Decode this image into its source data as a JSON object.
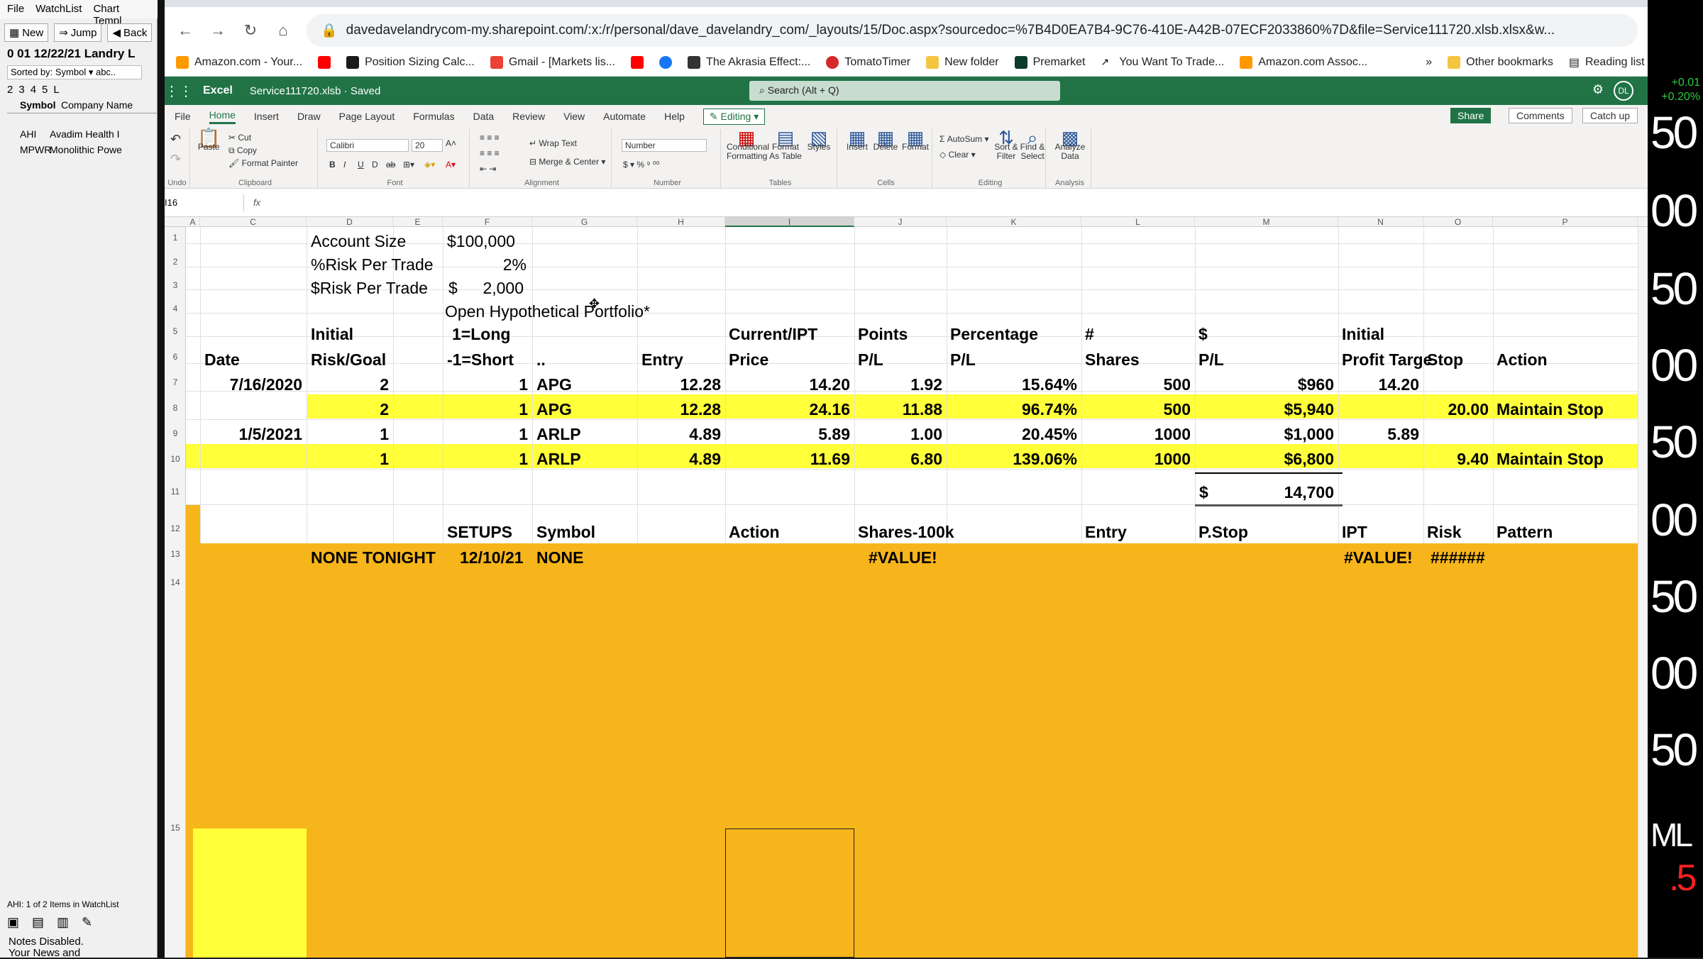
{
  "left_app": {
    "menu": [
      "File",
      "WatchList",
      "Chart Templ"
    ],
    "toolbar": {
      "new": "New",
      "jump": "Jump",
      "back": "Back"
    },
    "title": "0 01 12/22/21 Landry L",
    "sort_label": "Sorted by: Symbol ▾ abc..",
    "tabs": [
      "2",
      "3",
      "4",
      "5",
      "L"
    ],
    "columns": [
      "Symbol",
      "Company Name"
    ],
    "rows": [
      {
        "symbol": "AHI",
        "company": "Avadim Health I"
      },
      {
        "symbol": "MPWR",
        "company": "Monolithic Powe"
      }
    ],
    "status": "AHI: 1 of 2 Items in WatchList",
    "notes": [
      "Notes Disabled.",
      "Your News and"
    ]
  },
  "price_scale": {
    "change1": "+0.01",
    "change2": "+0.20%",
    "labels": [
      "50",
      "00",
      "50",
      "00",
      "50",
      "00",
      "50",
      "00",
      "50"
    ],
    "footer1": "ML",
    "footer2": ".5"
  },
  "browser": {
    "url": "davedavelandrycom-my.sharepoint.com/:x:/r/personal/dave_davelandry_com/_layouts/15/Doc.aspx?sourcedoc=%7B4D0EA7B4-9C76-410E-A42B-07ECF2033860%7D&file=Service111720.xlsb.xlsx&w...",
    "bookmarks": [
      "Amazon.com - Your...",
      "Position Sizing Calc...",
      "Gmail - [Markets lis...",
      "The Akrasia Effect:...",
      "TomatoTimer",
      "New folder",
      "Premarket",
      "You Want To Trade...",
      "Amazon.com Assoc..."
    ],
    "other_bookmarks": "Other bookmarks",
    "reading_list": "Reading list"
  },
  "excel": {
    "app_name": "Excel",
    "doc_title": "Service111720.xlsb · Saved",
    "search_placeholder": "Search (Alt + Q)",
    "avatar": "DL",
    "tabs": [
      "File",
      "Home",
      "Insert",
      "Draw",
      "Page Layout",
      "Formulas",
      "Data",
      "Review",
      "View",
      "Automate",
      "Help"
    ],
    "active_tab": "Home",
    "editing": "Editing",
    "share": "Share",
    "comments": "Comments",
    "catchup": "Catch up",
    "ribbon": {
      "undo_label": "Undo",
      "paste": "Paste",
      "cut": "Cut",
      "copy": "Copy",
      "format_painter": "Format Painter",
      "clipboard": "Clipboard",
      "font_name": "Calibri",
      "font_size": "20",
      "font": "Font",
      "wrap_text": "Wrap Text",
      "merge_center": "Merge & Center",
      "alignment": "Alignment",
      "number_format": "Number",
      "number": "Number",
      "conditional_formatting": "Conditional Formatting",
      "format_as_table": "Format As Table",
      "styles": "Styles",
      "tables": "Tables",
      "insert": "Insert",
      "delete": "Delete",
      "format": "Format",
      "cells": "Cells",
      "autosum": "AutoSum",
      "clear": "Clear",
      "sort_filter": "Sort & Filter",
      "find_select": "Find & Select",
      "editing_group": "Editing",
      "analyze_data": "Analyze Data",
      "analysis": "Analysis"
    },
    "name_box": "I16",
    "fx": "fx",
    "columns": [
      "A",
      "C",
      "D",
      "E",
      "F",
      "G",
      "H",
      "I",
      "J",
      "K",
      "L",
      "M",
      "N",
      "O",
      "P"
    ],
    "row_numbers": [
      "1",
      "2",
      "3",
      "4",
      "5",
      "6",
      "7",
      "8",
      "9",
      "10",
      "11",
      "12",
      "13",
      "14",
      "15"
    ],
    "sheet": {
      "account_size_label": "Account Size",
      "account_size": "$100,000",
      "risk_pct_label": "%Risk Per Trade",
      "risk_pct": "2%",
      "risk_dollar_label": "$Risk Per Trade",
      "risk_dollar_sign": "$",
      "risk_dollar": "2,000",
      "portfolio_title": "Open Hypothetical Portfolio*",
      "hdr5": {
        "d": "Initial",
        "f": "1=Long",
        "i": "Current/IPT",
        "j": "Points",
        "k": "Percentage",
        "l": "#",
        "m": "$",
        "n": "Initial"
      },
      "hdr6": {
        "c": "Date",
        "d": "Risk/Goal",
        "f": "-1=Short",
        "g": "..",
        "h": "Entry",
        "i": "Price",
        "j": "P/L",
        "k": "P/L",
        "l": "Shares",
        "m": "P/L",
        "n": "Profit Targe",
        "o": "Stop",
        "p": "Action"
      },
      "rows": [
        {
          "date": "7/16/2020",
          "risk": "2",
          "ls": "1",
          "sym": "APG",
          "entry": "12.28",
          "price": "14.20",
          "pts": "1.92",
          "pct": "15.64%",
          "shares": "500",
          "pl": "$960",
          "target": "14.20",
          "stop": "",
          "action": ""
        },
        {
          "date": "",
          "risk": "2",
          "ls": "1",
          "sym": "APG",
          "entry": "12.28",
          "price": "24.16",
          "pts": "11.88",
          "pct": "96.74%",
          "shares": "500",
          "pl": "$5,940",
          "target": "",
          "stop": "20.00",
          "action": "Maintain Stop"
        },
        {
          "date": "1/5/2021",
          "risk": "1",
          "ls": "1",
          "sym": "ARLP",
          "entry": "4.89",
          "price": "5.89",
          "pts": "1.00",
          "pct": "20.45%",
          "shares": "1000",
          "pl": "$1,000",
          "target": "5.89",
          "stop": "",
          "action": ""
        },
        {
          "date": "",
          "risk": "1",
          "ls": "1",
          "sym": "ARLP",
          "entry": "4.89",
          "price": "11.69",
          "pts": "6.80",
          "pct": "139.06%",
          "shares": "1000",
          "pl": "$6,800",
          "target": "",
          "stop": "9.40",
          "action": "Maintain Stop"
        }
      ],
      "total_sign": "$",
      "total": "14,700",
      "hdr12": {
        "f": "SETUPS",
        "g": "Symbol",
        "i": "Action",
        "j": "Shares-100k",
        "l": "Entry",
        "m": "P.Stop",
        "n": "IPT",
        "o": "Risk",
        "p": "Pattern"
      },
      "row13": {
        "d": "NONE TONIGHT",
        "f": "12/10/21",
        "g": "NONE",
        "j": "#VALUE!",
        "n": "#VALUE!",
        "o": "######"
      }
    },
    "colors": {
      "yellow": "#ffff3a",
      "orange": "#f7b51c",
      "excel_green": "#217346"
    }
  }
}
